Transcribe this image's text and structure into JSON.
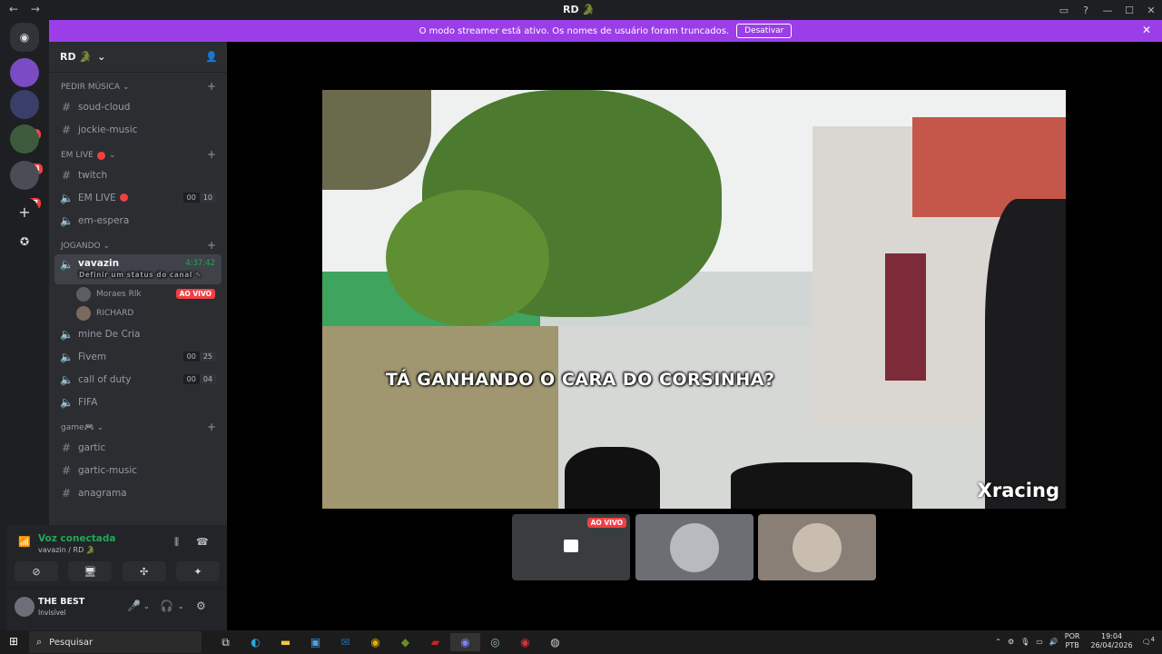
{
  "titlebar": {
    "back": "←",
    "forward": "→",
    "title": "RD 🐊",
    "inbox_icon": "inbox-icon",
    "help_icon": "help-icon",
    "min": "—",
    "max": "☐",
    "close": "✕"
  },
  "banner": {
    "text": "O modo streamer está ativo. Os nomes de usuário foram truncados.",
    "button": "Desativar",
    "close": "✕"
  },
  "servers": {
    "badges": [
      "19",
      "938",
      "37"
    ],
    "home_icon": "discord-icon",
    "add": "+",
    "explore": "compass-icon"
  },
  "server_header": {
    "name": "RD 🐊",
    "chevron": "⌄",
    "invite_icon": "add-member-icon"
  },
  "categories": {
    "pedir": {
      "label": "PEDIR MÚSICA ⌄",
      "channels": [
        "soud-cloud",
        "jockie-music"
      ]
    },
    "emlive": {
      "label": "EM LIVE",
      "twitch": "twitch",
      "emlive": "EM LIVE",
      "emlive_count": [
        "00",
        "10"
      ],
      "espera": "em-espera"
    },
    "jogando": {
      "label": "JOGANDO ⌄",
      "vavazin": "vavazin",
      "vavazin_sub": "Definir um status do canal ✎",
      "vavazin_time": "4:37:42",
      "users": [
        {
          "name": "Moraes Rlk",
          "live": "AO VIVO"
        },
        {
          "name": "RICHARD"
        }
      ],
      "mine": "mine De Cria",
      "fivem": "Fivem",
      "fivem_count": [
        "00",
        "25"
      ],
      "cod": "call of duty",
      "cod_count": [
        "00",
        "04"
      ],
      "fifa": "FIFA"
    },
    "game": {
      "label": "game🎮 ⌄",
      "channels": [
        "gartic",
        "gartic-music",
        "anagrama"
      ]
    }
  },
  "voice": {
    "status": "Voz conectada",
    "channel": "vavazin / RD 🐊"
  },
  "user_panel": {
    "name": "THE BEST",
    "status": "Invisível"
  },
  "stream": {
    "subtitle": "TÁ GANHANDO O CARA DO CORSINHA?",
    "watermark": "Xracing",
    "thumb_live": "AO VIVO"
  },
  "taskbar": {
    "search": "Pesquisar",
    "lang1": "POR",
    "lang2": "PTB",
    "time": "19:04",
    "date": "26/04/2026",
    "notif": "4"
  }
}
